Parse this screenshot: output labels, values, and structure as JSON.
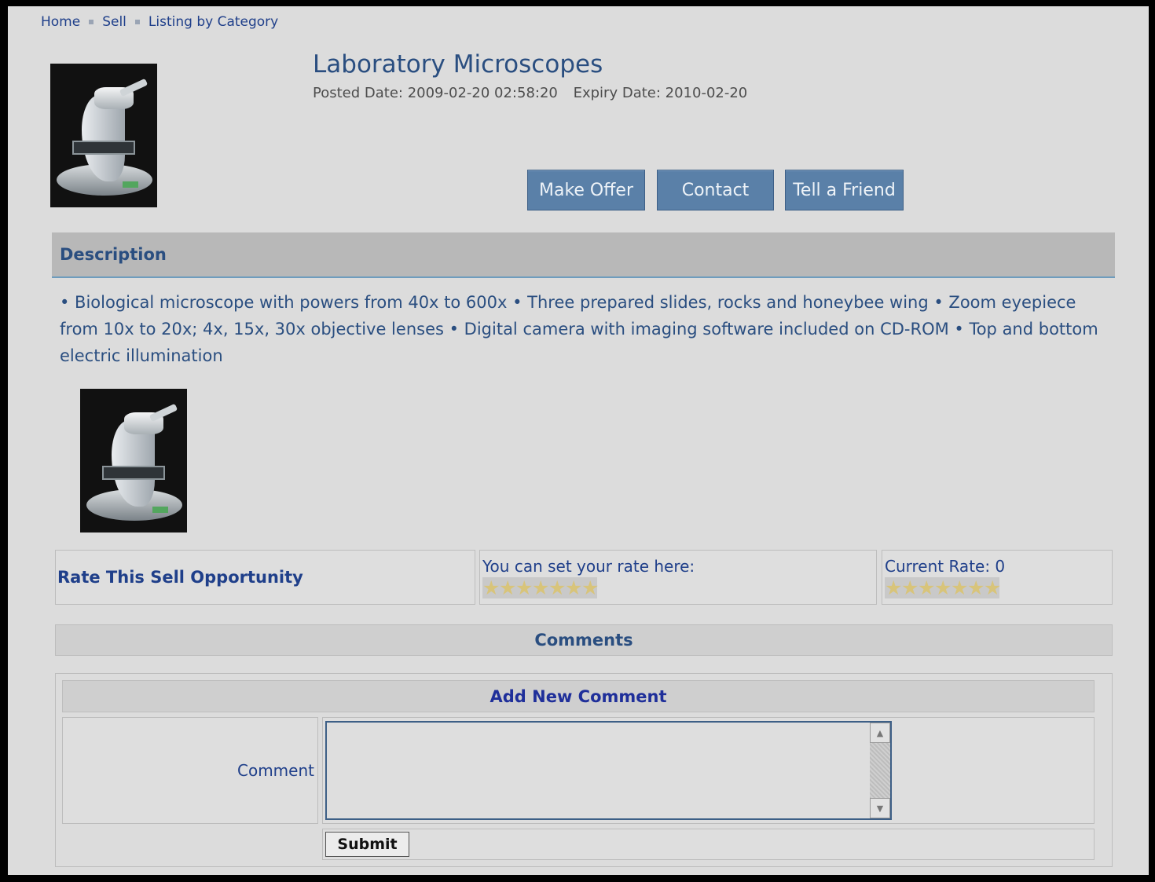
{
  "breadcrumb": {
    "items": [
      "Home",
      "Sell",
      "Listing by Category"
    ]
  },
  "listing": {
    "title": "Laboratory Microscopes",
    "posted": "Posted Date: 2009-02-20 02:58:20",
    "expiry": "Expiry Date: 2010-02-20"
  },
  "actions": {
    "make_offer": "Make Offer",
    "contact": "Contact",
    "tell_friend": "Tell a Friend"
  },
  "description": {
    "header": "Description",
    "text": "• Biological microscope with powers from 40x to 600x • Three prepared slides, rocks and honeybee wing • Zoom eyepiece from 10x to 20x; 4x, 15x, 30x objective lenses • Digital camera with imaging software included on CD-ROM • Top and bottom electric illumination"
  },
  "rating": {
    "label": "Rate This Sell Opportunity",
    "set_text": "You can set your rate here:",
    "current_text": "Current Rate: 0",
    "current_value": 0,
    "max": 7
  },
  "comments": {
    "header": "Comments",
    "add_header": "Add New Comment",
    "comment_label": "Comment",
    "comment_value": "",
    "submit": "Submit"
  },
  "icons": [
    "product-photo",
    "star-icon",
    "scroll-up-icon",
    "scroll-down-icon"
  ]
}
